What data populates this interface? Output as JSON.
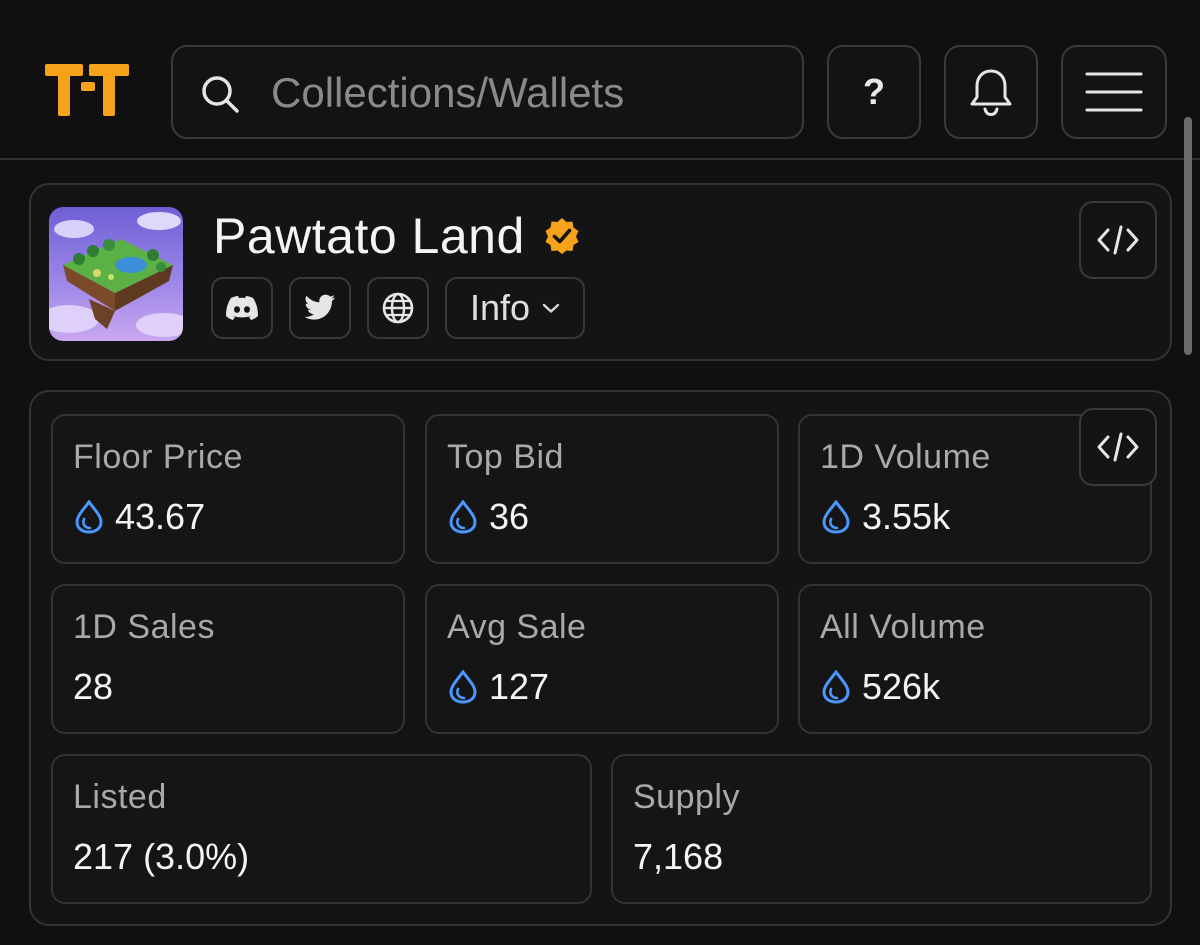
{
  "search": {
    "placeholder": "Collections/Wallets"
  },
  "header": {
    "help_label": "?"
  },
  "colors": {
    "accent": "#f7a21b",
    "drop": "#4a98ff",
    "border": "#333333"
  },
  "collection": {
    "name": "Pawtato Land",
    "verified": true,
    "info_label": "Info",
    "links": [
      "discord-icon",
      "twitter-icon",
      "globe-icon"
    ]
  },
  "stats": [
    {
      "label": "Floor Price",
      "value": "43.67",
      "icon": "drop-icon"
    },
    {
      "label": "Top Bid",
      "value": "36",
      "icon": "drop-icon"
    },
    {
      "label": "1D Volume",
      "value": "3.55k",
      "icon": "drop-icon"
    },
    {
      "label": "1D Sales",
      "value": "28",
      "icon": null
    },
    {
      "label": "Avg Sale",
      "value": "127",
      "icon": "drop-icon"
    },
    {
      "label": "All Volume",
      "value": "526k",
      "icon": "drop-icon"
    },
    {
      "label": "Listed",
      "value": "217 (3.0%)",
      "icon": null
    },
    {
      "label": "Supply",
      "value": "7,168",
      "icon": null
    }
  ]
}
